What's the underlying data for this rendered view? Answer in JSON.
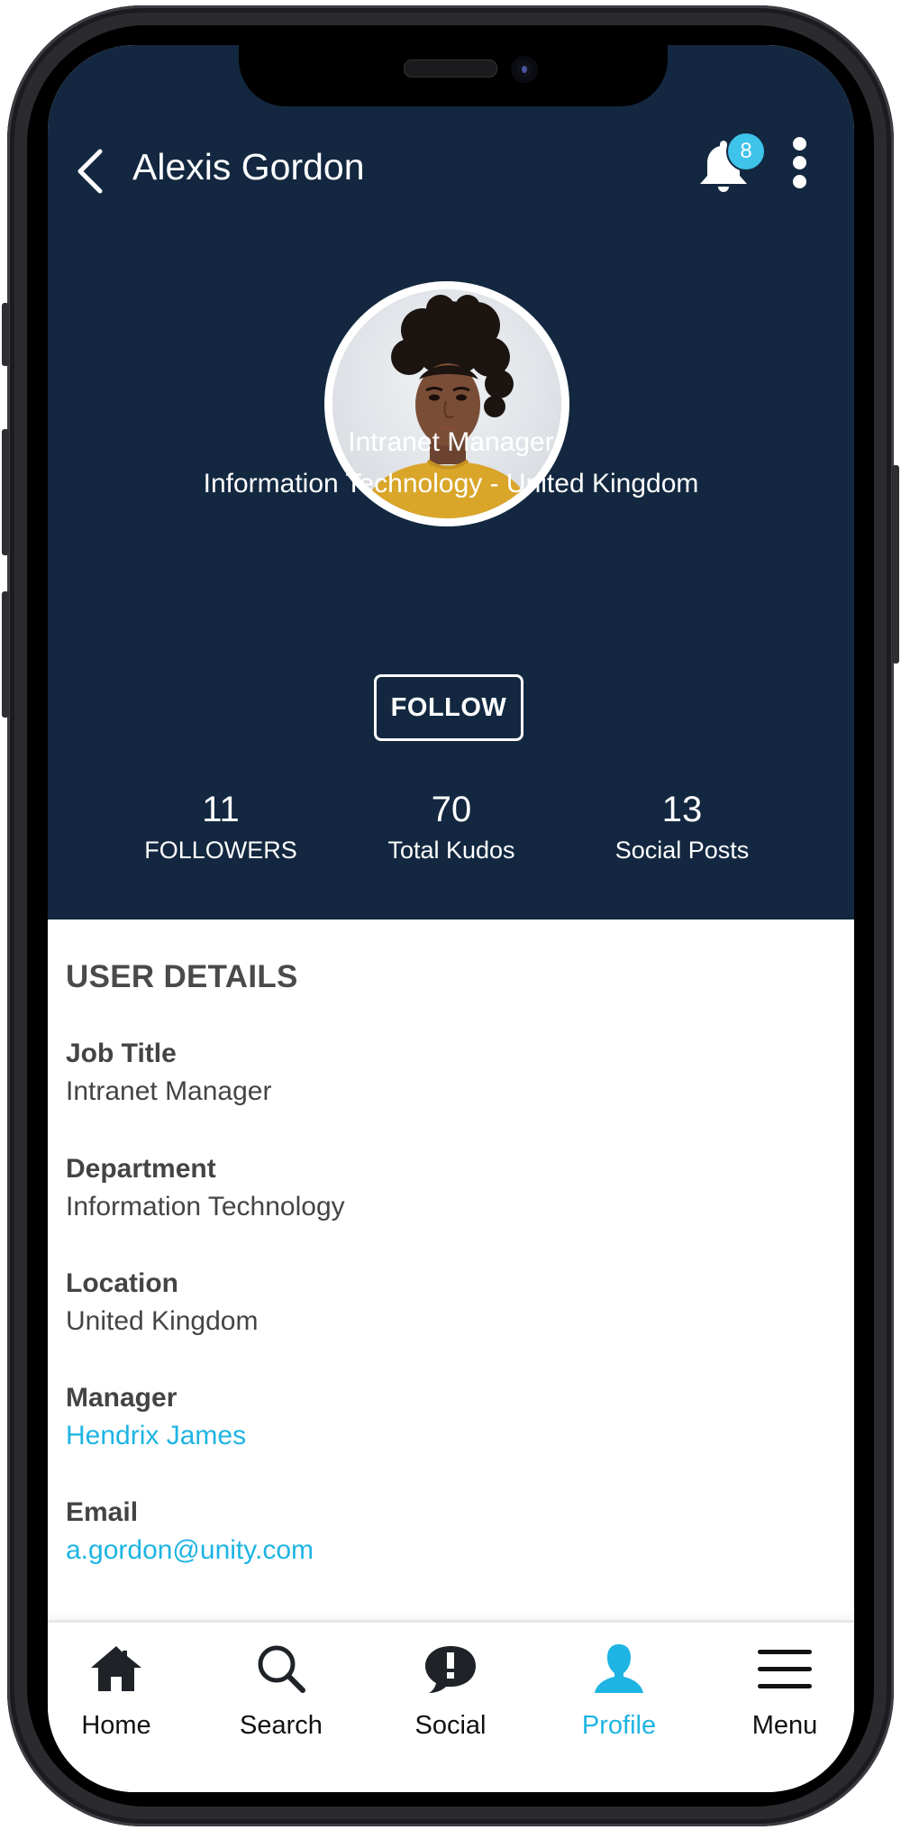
{
  "header": {
    "title": "Alexis Gordon",
    "notification_count": "8",
    "icons": {
      "back": "chevron-left-icon",
      "notifications": "bell-icon",
      "more": "more-vertical-icon"
    }
  },
  "profile": {
    "job_title": "Intranet Manager",
    "department_location": "Information Technology - United Kingdom",
    "follow_label": "FOLLOW",
    "stats": [
      {
        "value": "11",
        "label": "FOLLOWERS"
      },
      {
        "value": "70",
        "label": "Total Kudos"
      },
      {
        "value": "13",
        "label": "Social Posts"
      }
    ]
  },
  "details": {
    "section_title": "USER DETAILS",
    "fields": [
      {
        "label": "Job Title",
        "value": "Intranet Manager"
      },
      {
        "label": "Department",
        "value": "Information Technology"
      },
      {
        "label": "Location",
        "value": "United Kingdom"
      },
      {
        "label": "Manager",
        "value": "Hendrix James"
      },
      {
        "label": "Email",
        "value": "a.gordon@unity.com"
      }
    ]
  },
  "tabbar": {
    "active": "Profile",
    "items": [
      {
        "label": "Home",
        "icon": "home-icon"
      },
      {
        "label": "Search",
        "icon": "search-icon"
      },
      {
        "label": "Social",
        "icon": "speech-bubble-alert-icon"
      },
      {
        "label": "Profile",
        "icon": "person-icon"
      },
      {
        "label": "Menu",
        "icon": "hamburger-menu-icon"
      }
    ]
  },
  "colors": {
    "header_bg": "#132840",
    "accent": "#1eb4e3",
    "badge": "#3ec3ea",
    "text_dark": "#444444"
  }
}
